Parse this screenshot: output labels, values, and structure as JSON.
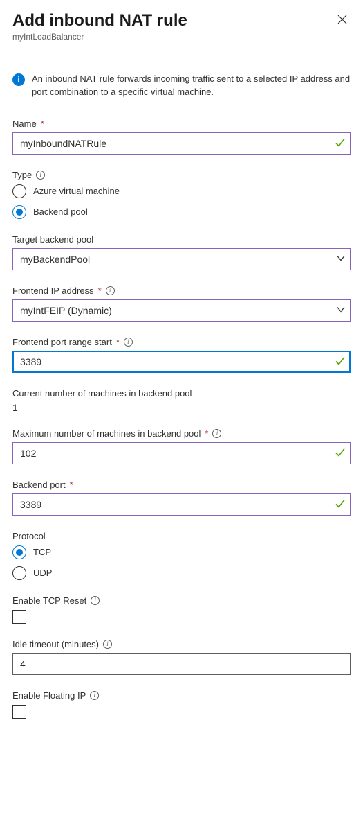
{
  "header": {
    "title": "Add inbound NAT rule",
    "subtitle": "myIntLoadBalancer"
  },
  "info": {
    "text": "An inbound NAT rule forwards incoming traffic sent to a selected IP address and port combination to a specific virtual machine."
  },
  "form": {
    "name": {
      "label": "Name",
      "value": "myInboundNATRule"
    },
    "type": {
      "label": "Type",
      "option_vm": "Azure virtual machine",
      "option_pool": "Backend pool",
      "selected": "pool"
    },
    "targetPool": {
      "label": "Target backend pool",
      "value": "myBackendPool"
    },
    "frontendIp": {
      "label": "Frontend IP address",
      "value": "myIntFEIP (Dynamic)"
    },
    "frontendPortStart": {
      "label": "Frontend port range start",
      "value": "3389"
    },
    "currentMachines": {
      "label": "Current number of machines in backend pool",
      "value": "1"
    },
    "maxMachines": {
      "label": "Maximum number of machines in backend pool",
      "value": "102"
    },
    "backendPort": {
      "label": "Backend port",
      "value": "3389"
    },
    "protocol": {
      "label": "Protocol",
      "option_tcp": "TCP",
      "option_udp": "UDP",
      "selected": "tcp"
    },
    "tcpReset": {
      "label": "Enable TCP Reset",
      "checked": false
    },
    "idleTimeout": {
      "label": "Idle timeout (minutes)",
      "value": "4"
    },
    "floatingIp": {
      "label": "Enable Floating IP",
      "checked": false
    }
  }
}
